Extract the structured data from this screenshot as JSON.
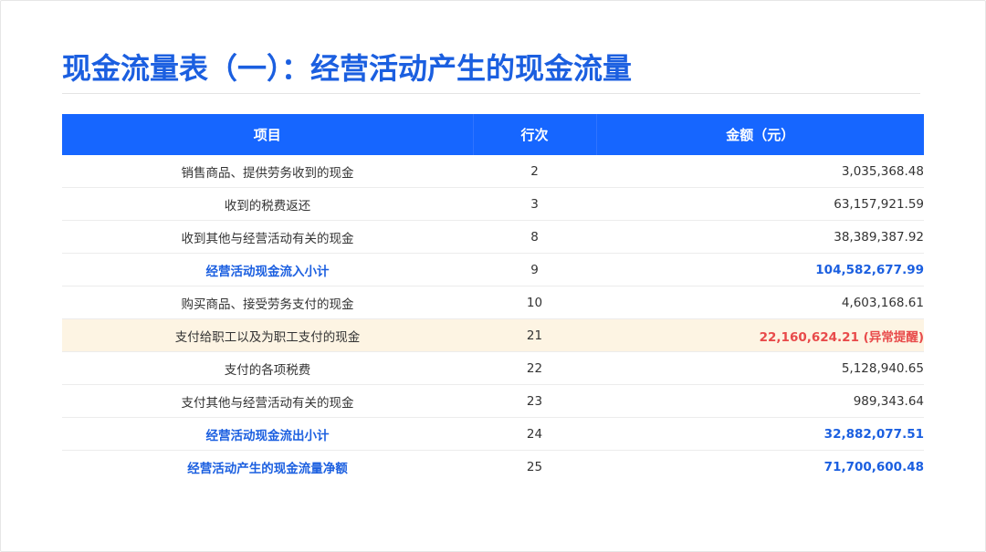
{
  "title": "现金流量表（一）：经营活动产生的现金流量",
  "table": {
    "headers": {
      "item": "项目",
      "row": "行次",
      "amount": "金额（元）"
    },
    "rows": [
      {
        "item": "销售商品、提供劳务收到的现金",
        "row": "2",
        "amount": "3,035,368.48",
        "kind": "normal"
      },
      {
        "item": "收到的税费返还",
        "row": "3",
        "amount": "63,157,921.59",
        "kind": "normal"
      },
      {
        "item": "收到其他与经营活动有关的现金",
        "row": "8",
        "amount": "38,389,387.92",
        "kind": "normal"
      },
      {
        "item": "经营活动现金流入小计",
        "row": "9",
        "amount": "104,582,677.99",
        "kind": "subtotal"
      },
      {
        "item": "购买商品、接受劳务支付的现金",
        "row": "10",
        "amount": "4,603,168.61",
        "kind": "normal"
      },
      {
        "item": "支付给职工以及为职工支付的现金",
        "row": "21",
        "amount": "22,160,624.21 (异常提醒)",
        "kind": "alert"
      },
      {
        "item": "支付的各项税费",
        "row": "22",
        "amount": "5,128,940.65",
        "kind": "normal"
      },
      {
        "item": "支付其他与经营活动有关的现金",
        "row": "23",
        "amount": "989,343.64",
        "kind": "normal"
      },
      {
        "item": "经营活动现金流出小计",
        "row": "24",
        "amount": "32,882,077.51",
        "kind": "subtotal"
      },
      {
        "item": "经营活动产生的现金流量净额",
        "row": "25",
        "amount": "71,700,600.48",
        "kind": "subtotal"
      }
    ]
  },
  "colors": {
    "title": "#1b5fe0",
    "header_bg": "#1666ff",
    "subtotal_text": "#1b5fe0",
    "alert_bg": "#fdf4e3",
    "alert_text": "#e84a4a"
  }
}
